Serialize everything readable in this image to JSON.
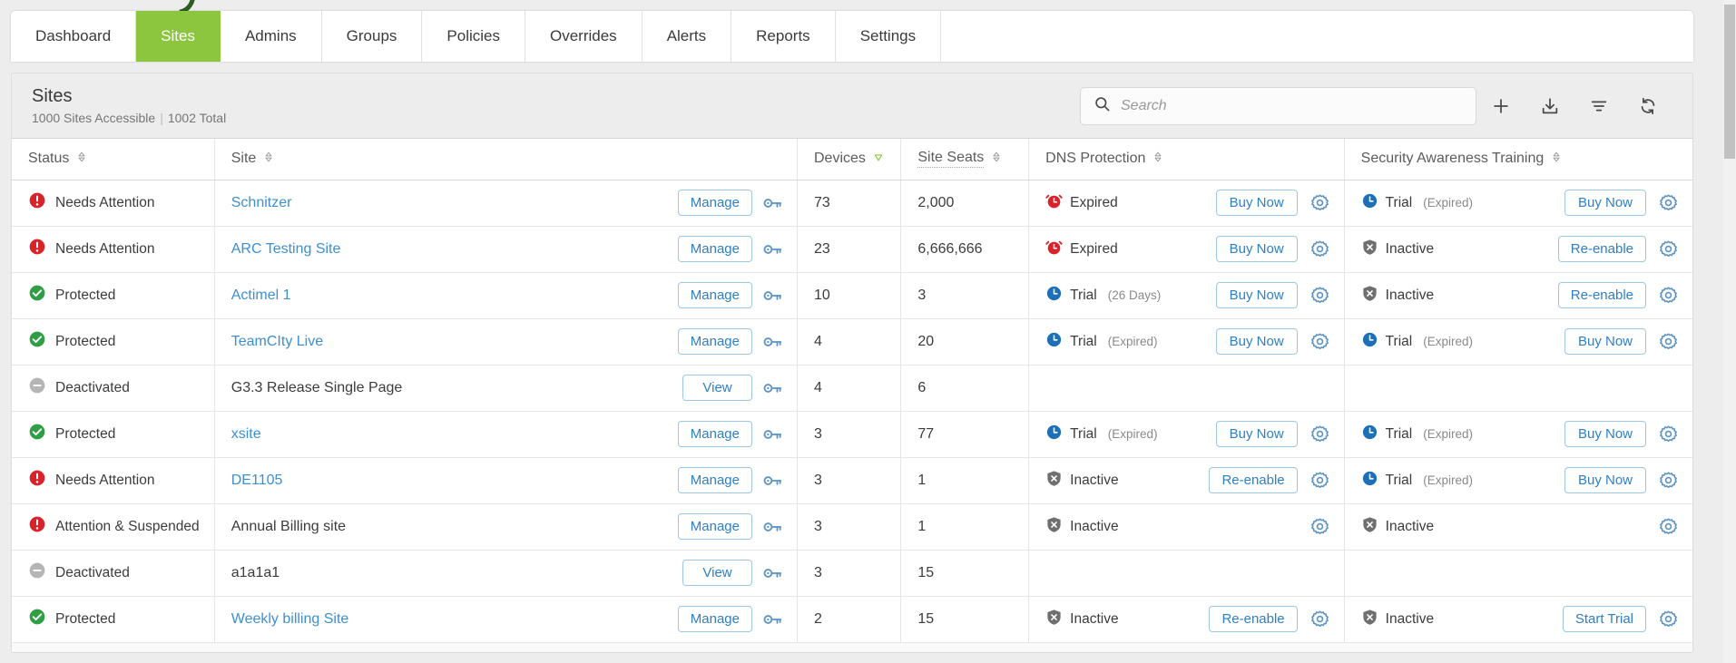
{
  "tabs": [
    {
      "label": "Dashboard",
      "active": false
    },
    {
      "label": "Sites",
      "active": true
    },
    {
      "label": "Admins",
      "active": false
    },
    {
      "label": "Groups",
      "active": false
    },
    {
      "label": "Policies",
      "active": false
    },
    {
      "label": "Overrides",
      "active": false
    },
    {
      "label": "Alerts",
      "active": false
    },
    {
      "label": "Reports",
      "active": false
    },
    {
      "label": "Settings",
      "active": false
    }
  ],
  "header": {
    "title": "Sites",
    "accessible": "1000 Sites Accessible",
    "separator": "|",
    "total": "1002 Total"
  },
  "search": {
    "value": "",
    "placeholder": "Search",
    "icon": "search-icon"
  },
  "toolbar_icons": [
    {
      "name": "add-site-icon",
      "title": "Add"
    },
    {
      "name": "download-icon",
      "title": "Export"
    },
    {
      "name": "filter-icon",
      "title": "Filter"
    },
    {
      "name": "refresh-icon",
      "title": "Refresh"
    }
  ],
  "columns": [
    {
      "label": "Status",
      "sort": "none"
    },
    {
      "label": "Site",
      "sort": "none"
    },
    {
      "label": "Devices",
      "sort": "desc"
    },
    {
      "label": "Site Seats",
      "sort": "none",
      "dotted": true
    },
    {
      "label": "DNS Protection",
      "sort": "none"
    },
    {
      "label": "Security Awareness Training",
      "sort": "none"
    }
  ],
  "colors": {
    "accent_green": "#8cc63e",
    "link_blue": "#3d8fd1",
    "button_blue": "#2f7fc4",
    "status_red": "#d8232a",
    "status_green": "#2f9e44",
    "status_grey": "#b5b5b5",
    "shield_grey": "#6f6f6f",
    "clock_blue": "#1d6fb8",
    "gear_blue": "#5b93c4"
  },
  "rows": [
    {
      "status": "Needs Attention",
      "status_icon": "alert-circle-icon",
      "site": "Schnitzer",
      "site_link": true,
      "action": "Manage",
      "key_icon": "key-icon",
      "devices": "73",
      "seats": "2,000",
      "dns": {
        "state": "Expired",
        "icon": "alarm-clock-icon",
        "sub": "",
        "button": "Buy Now",
        "gear": true
      },
      "sat": {
        "state": "Trial",
        "icon": "clock-icon",
        "sub": "(Expired)",
        "button": "Buy Now",
        "gear": true
      }
    },
    {
      "status": "Needs Attention",
      "status_icon": "alert-circle-icon",
      "site": "ARC Testing Site",
      "site_link": true,
      "action": "Manage",
      "key_icon": "key-icon",
      "devices": "23",
      "seats": "6,666,666",
      "dns": {
        "state": "Expired",
        "icon": "alarm-clock-icon",
        "sub": "",
        "button": "Buy Now",
        "gear": true
      },
      "sat": {
        "state": "Inactive",
        "icon": "shield-x-icon",
        "sub": "",
        "button": "Re-enable",
        "gear": true
      }
    },
    {
      "status": "Protected",
      "status_icon": "check-circle-icon",
      "site": "Actimel 1",
      "site_link": true,
      "action": "Manage",
      "key_icon": "key-icon",
      "devices": "10",
      "seats": "3",
      "dns": {
        "state": "Trial",
        "icon": "clock-icon",
        "sub": "(26 Days)",
        "button": "Buy Now",
        "gear": true
      },
      "sat": {
        "state": "Inactive",
        "icon": "shield-x-icon",
        "sub": "",
        "button": "Re-enable",
        "gear": true
      }
    },
    {
      "status": "Protected",
      "status_icon": "check-circle-icon",
      "site": "TeamCIty Live",
      "site_link": true,
      "action": "Manage",
      "key_icon": "key-icon",
      "devices": "4",
      "seats": "20",
      "dns": {
        "state": "Trial",
        "icon": "clock-icon",
        "sub": "(Expired)",
        "button": "Buy Now",
        "gear": true
      },
      "sat": {
        "state": "Trial",
        "icon": "clock-icon",
        "sub": "(Expired)",
        "button": "Buy Now",
        "gear": true
      }
    },
    {
      "status": "Deactivated",
      "status_icon": "minus-circle-icon",
      "site": "G3.3 Release Single Page",
      "site_link": false,
      "action": "View",
      "key_icon": "key-icon",
      "devices": "4",
      "seats": "6",
      "dns": {
        "state": "",
        "icon": "",
        "sub": "",
        "button": "",
        "gear": false
      },
      "sat": {
        "state": "",
        "icon": "",
        "sub": "",
        "button": "",
        "gear": false
      }
    },
    {
      "status": "Protected",
      "status_icon": "check-circle-icon",
      "site": "xsite",
      "site_link": true,
      "action": "Manage",
      "key_icon": "key-icon",
      "devices": "3",
      "seats": "77",
      "dns": {
        "state": "Trial",
        "icon": "clock-icon",
        "sub": "(Expired)",
        "button": "Buy Now",
        "gear": true
      },
      "sat": {
        "state": "Trial",
        "icon": "clock-icon",
        "sub": "(Expired)",
        "button": "Buy Now",
        "gear": true
      }
    },
    {
      "status": "Needs Attention",
      "status_icon": "alert-circle-icon",
      "site": "DE1105",
      "site_link": true,
      "action": "Manage",
      "key_icon": "key-icon",
      "devices": "3",
      "seats": "1",
      "dns": {
        "state": "Inactive",
        "icon": "shield-x-icon",
        "sub": "",
        "button": "Re-enable",
        "gear": true
      },
      "sat": {
        "state": "Trial",
        "icon": "clock-icon",
        "sub": "(Expired)",
        "button": "Buy Now",
        "gear": true
      }
    },
    {
      "status": "Attention & Suspended",
      "status_icon": "alert-circle-icon",
      "site": "Annual Billing site",
      "site_link": false,
      "action": "Manage",
      "key_icon": "key-icon",
      "devices": "3",
      "seats": "1",
      "dns": {
        "state": "Inactive",
        "icon": "shield-x-icon",
        "sub": "",
        "button": "",
        "gear": true
      },
      "sat": {
        "state": "Inactive",
        "icon": "shield-x-icon",
        "sub": "",
        "button": "",
        "gear": true
      }
    },
    {
      "status": "Deactivated",
      "status_icon": "minus-circle-icon",
      "site": "a1a1a1",
      "site_link": false,
      "action": "View",
      "key_icon": "key-icon",
      "devices": "3",
      "seats": "15",
      "dns": {
        "state": "",
        "icon": "",
        "sub": "",
        "button": "",
        "gear": false
      },
      "sat": {
        "state": "",
        "icon": "",
        "sub": "",
        "button": "",
        "gear": false
      }
    },
    {
      "status": "Protected",
      "status_icon": "check-circle-icon",
      "site": "Weekly billing Site",
      "site_link": true,
      "action": "Manage",
      "key_icon": "key-icon",
      "devices": "2",
      "seats": "15",
      "dns": {
        "state": "Inactive",
        "icon": "shield-x-icon",
        "sub": "",
        "button": "Re-enable",
        "gear": true
      },
      "sat": {
        "state": "Inactive",
        "icon": "shield-x-icon",
        "sub": "",
        "button": "Start Trial",
        "gear": true
      }
    }
  ]
}
